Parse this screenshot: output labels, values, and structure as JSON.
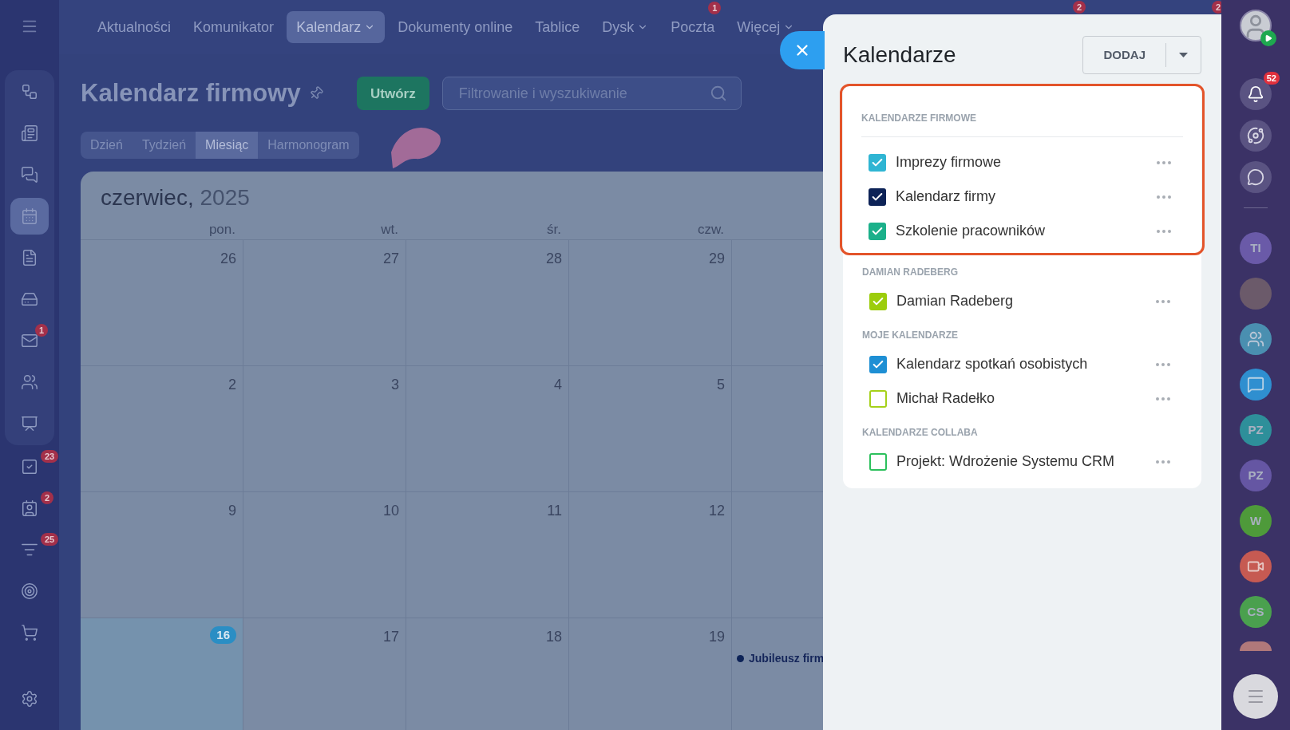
{
  "top_nav": {
    "items": [
      {
        "label": "Aktualności",
        "selected": false,
        "dropdown": false
      },
      {
        "label": "Komunikator",
        "selected": false,
        "dropdown": false
      },
      {
        "label": "Kalendarz",
        "selected": true,
        "dropdown": true
      },
      {
        "label": "Dokumenty online",
        "selected": false,
        "dropdown": false
      },
      {
        "label": "Tablice",
        "selected": false,
        "dropdown": false
      },
      {
        "label": "Dysk",
        "selected": false,
        "dropdown": true
      },
      {
        "label": "Poczta",
        "selected": false,
        "dropdown": false,
        "badge": "1"
      },
      {
        "label": "Więcej",
        "selected": false,
        "dropdown": true
      }
    ],
    "edge_badges": [
      "2",
      "2"
    ]
  },
  "left_sidebar": {
    "items": [
      {
        "selected": false
      },
      {
        "selected": false
      },
      {
        "selected": false
      },
      {
        "selected": true
      },
      {
        "selected": false
      },
      {
        "selected": false
      },
      {
        "selected": false,
        "badge": "1"
      },
      {
        "selected": false
      },
      {
        "selected": false
      },
      {
        "selected": false,
        "badge": "23"
      },
      {
        "selected": false,
        "badge": "2"
      },
      {
        "selected": false,
        "badge": "25"
      },
      {
        "selected": false
      },
      {
        "selected": false
      },
      {
        "selected": false
      }
    ]
  },
  "page": {
    "title": "Kalendarz firmowy",
    "create_button": "Utwórz",
    "search": {
      "placeholder": "Filtrowanie i wyszukiwanie"
    },
    "view_tabs": [
      {
        "label": "Dzień",
        "selected": false
      },
      {
        "label": "Tydzień",
        "selected": false
      },
      {
        "label": "Miesiąc",
        "selected": true
      },
      {
        "label": "Harmonogram",
        "selected": false
      }
    ]
  },
  "calendar": {
    "month": "czerwiec,",
    "year": "2025",
    "weekdays": [
      "pon.",
      "wt.",
      "śr.",
      "czw."
    ],
    "weeks": [
      {
        "days": [
          {
            "day": "26",
            "today": false
          },
          {
            "day": "27",
            "today": false
          },
          {
            "day": "28",
            "today": false
          },
          {
            "day": "29",
            "today": false
          }
        ]
      },
      {
        "days": [
          {
            "day": "2",
            "today": false
          },
          {
            "day": "3",
            "today": false
          },
          {
            "day": "4",
            "today": false
          },
          {
            "day": "5",
            "today": false
          }
        ]
      },
      {
        "days": [
          {
            "day": "9",
            "today": false
          },
          {
            "day": "10",
            "today": false
          },
          {
            "day": "11",
            "today": false
          },
          {
            "day": "12",
            "today": false
          }
        ]
      },
      {
        "days": [
          {
            "day": "16",
            "today": true
          },
          {
            "day": "17",
            "today": false
          },
          {
            "day": "18",
            "today": false
          },
          {
            "day": "19",
            "today": false
          }
        ],
        "events": [
          {
            "label": "Jubileusz firm",
            "color": "#0d2357"
          }
        ]
      }
    ]
  },
  "panel": {
    "title": "Kalendarze",
    "add_button": "DODAJ",
    "sections": [
      {
        "title": "KALENDARZE FIRMOWE",
        "highlighted": true,
        "calendars": [
          {
            "name": "Imprezy firmowe",
            "checked": true,
            "color": "#2fb5d3"
          },
          {
            "name": "Kalendarz firmy",
            "checked": true,
            "color": "#0d2357"
          },
          {
            "name": "Szkolenie pracowników",
            "checked": true,
            "color": "#1bb08a"
          }
        ]
      },
      {
        "title": "DAMIAN RADEBERG",
        "highlighted": false,
        "calendars": [
          {
            "name": "Damian Radeberg",
            "checked": true,
            "color": "#9ccd0c"
          }
        ]
      },
      {
        "title": "MOJE KALENDARZE",
        "highlighted": false,
        "calendars": [
          {
            "name": "Kalendarz spotkań osobistych",
            "checked": true,
            "color": "#1e8fd4"
          },
          {
            "name": "Michał Radełko",
            "checked": false,
            "color": "#a5d11a"
          }
        ]
      },
      {
        "title": "KALENDARZE COLLABA",
        "highlighted": false,
        "calendars": [
          {
            "name": "Projekt: Wdrożenie Systemu CRM",
            "checked": false,
            "color": "#2cc05c"
          }
        ]
      }
    ]
  },
  "right_sidebar": {
    "avatar": {
      "online": true
    },
    "notifications_badge": "52",
    "chats": [
      {
        "kind": "initials",
        "text": "TI",
        "color": "#6a5aa8"
      },
      {
        "kind": "photo",
        "color": "#6b5a6a"
      },
      {
        "kind": "group",
        "color": "#4a8fb0"
      },
      {
        "kind": "chat",
        "color": "#2f8fd0"
      },
      {
        "kind": "initials",
        "text": "PZ",
        "color": "#2e8f9a"
      },
      {
        "kind": "initials",
        "text": "PZ",
        "color": "#6556a3"
      },
      {
        "kind": "initials",
        "text": "W",
        "color": "#4e9a3a"
      },
      {
        "kind": "video",
        "color": "#c65a52"
      },
      {
        "kind": "initials",
        "text": "CS",
        "color": "#4aa04e"
      },
      {
        "kind": "cut",
        "color": "#b0787a"
      }
    ]
  }
}
